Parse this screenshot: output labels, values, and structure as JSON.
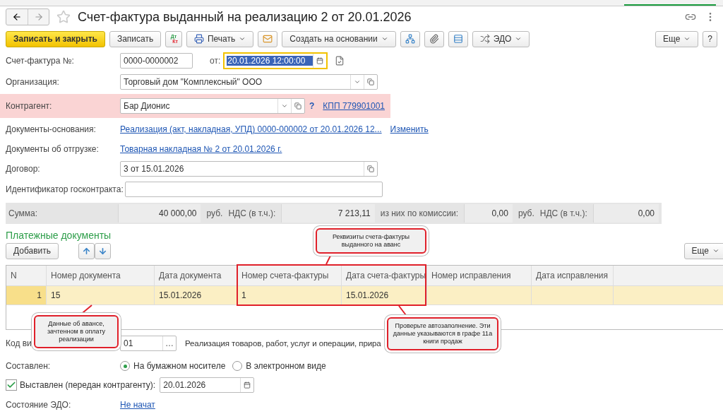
{
  "window": {
    "title": "Счет-фактура выданный на реализацию 2 от 20.01.2026",
    "favorite": false
  },
  "toolbar": {
    "buttons": [
      {
        "kind": "primary",
        "label": "Записать и закрыть"
      },
      {
        "kind": "plain",
        "label": "Записать"
      },
      {
        "kind": "dtkt",
        "top": "Дт",
        "bottom": "Кт"
      },
      {
        "kind": "print",
        "label": "Печать",
        "dropdown": true
      },
      {
        "kind": "mail"
      },
      {
        "kind": "plain",
        "label": "Создать на основании",
        "dropdown": true
      },
      {
        "kind": "structure"
      },
      {
        "kind": "attach"
      },
      {
        "kind": "list"
      },
      {
        "kind": "edo",
        "label": "ЭДО",
        "dropdown": true
      }
    ],
    "more": "Еще",
    "help": "?"
  },
  "header": {
    "number_label": "Счет-фактура №:",
    "number": "0000-0000002",
    "date_label": "от:",
    "date": "20.01.2026 12:00:00"
  },
  "fields": [
    {
      "kind": "select",
      "label": "Организация:",
      "value": "Торговый дом \"Комплексный\" ООО",
      "highlight": false
    },
    {
      "kind": "select",
      "label": "Контрагент:",
      "value": "Бар Дионис",
      "highlight": true,
      "hint": "?",
      "link": "КПП 779901001"
    },
    {
      "kind": "link",
      "label": "Документы-основания:",
      "value": "Реализация (акт, накладная, УПД) 0000-000002 от 20.01.2026 12...",
      "link": "Изменить"
    },
    {
      "kind": "link",
      "label": "Документы об отгрузке:",
      "value": "Товарная накладная № 2 от 20.01.2026 г."
    },
    {
      "kind": "open",
      "label": "Договор:",
      "value": "3 от 15.01.2026"
    },
    {
      "kind": "input",
      "label": "Идентификатор госконтракта:"
    }
  ],
  "totals": [
    {
      "kind": "label",
      "text": "Сумма:"
    },
    {
      "kind": "value",
      "text": "40 000,00"
    },
    {
      "kind": "label",
      "text": "руб."
    },
    {
      "kind": "label",
      "text": "НДС (в т.ч.):"
    },
    {
      "kind": "value",
      "text": "7 213,11"
    },
    {
      "kind": "label",
      "text": "из них по комиссии:"
    },
    {
      "kind": "value",
      "text": "0,00"
    },
    {
      "kind": "label",
      "text": "руб."
    },
    {
      "kind": "label",
      "text": "НДС (в т.ч.):"
    },
    {
      "kind": "value",
      "text": "0,00"
    }
  ],
  "payments": {
    "title": "Платежные документы",
    "add": "Добавить",
    "more": "Еще",
    "columns": [
      "N",
      "Номер документа",
      "Дата документа",
      "Номер счета-фактуры",
      "Дата счета-фактуры",
      "Номер исправления",
      "Дата исправления"
    ],
    "rows": [
      {
        "selected": true,
        "cells": [
          "1",
          "15",
          "15.01.2026",
          "1",
          "15.01.2026",
          "",
          ""
        ]
      }
    ]
  },
  "code": {
    "label": "Код ви",
    "value": "01",
    "choose": "…",
    "description": "Реализация товаров, работ, услуг и операции, прира"
  },
  "composed": {
    "label": "Составлен:",
    "options": [
      {
        "label": "На бумажном носителе",
        "selected": true
      },
      {
        "label": "В электронном виде",
        "selected": false
      }
    ]
  },
  "issued": {
    "label": "Выставлен (передан контрагенту):",
    "checked": true,
    "date": "20.01.2026"
  },
  "edo_state": {
    "label": "Состояние ЭДО:",
    "value": "Не начат"
  },
  "callouts": [
    {
      "text": "Реквизиты счета-фактуры выданного на аванс"
    },
    {
      "text": "Данные об авансе, зачтенном в оплату реализации"
    },
    {
      "text": "Проверьте автозаполнение. Эти данные указываются в графе 11а книги продаж"
    }
  ]
}
